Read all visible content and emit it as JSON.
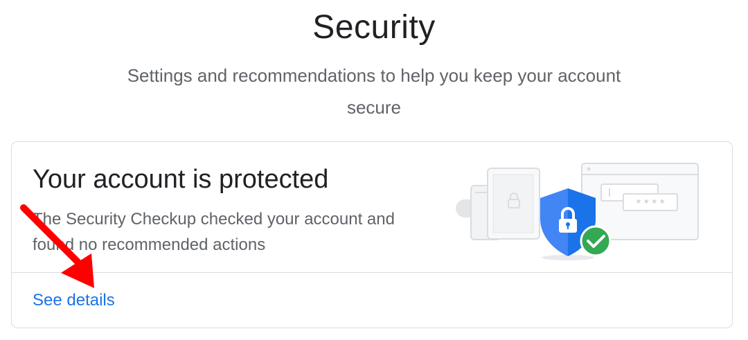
{
  "header": {
    "title": "Security",
    "subtitle": "Settings and recommendations to help you keep your account secure"
  },
  "card": {
    "heading": "Your account is protected",
    "body": "The Security Checkup checked your account and found no recommended actions",
    "link_label": "See details",
    "illustration_icons": [
      "phone-icon",
      "tablet-icon",
      "browser-window-icon",
      "shield-lock-icon",
      "checkmark-icon",
      "password-field-icon"
    ],
    "password_mask": "* * * *"
  },
  "colors": {
    "link": "#1a73e8",
    "shield": "#4285f4",
    "check": "#34a853",
    "annotation_arrow": "#ff0000"
  }
}
